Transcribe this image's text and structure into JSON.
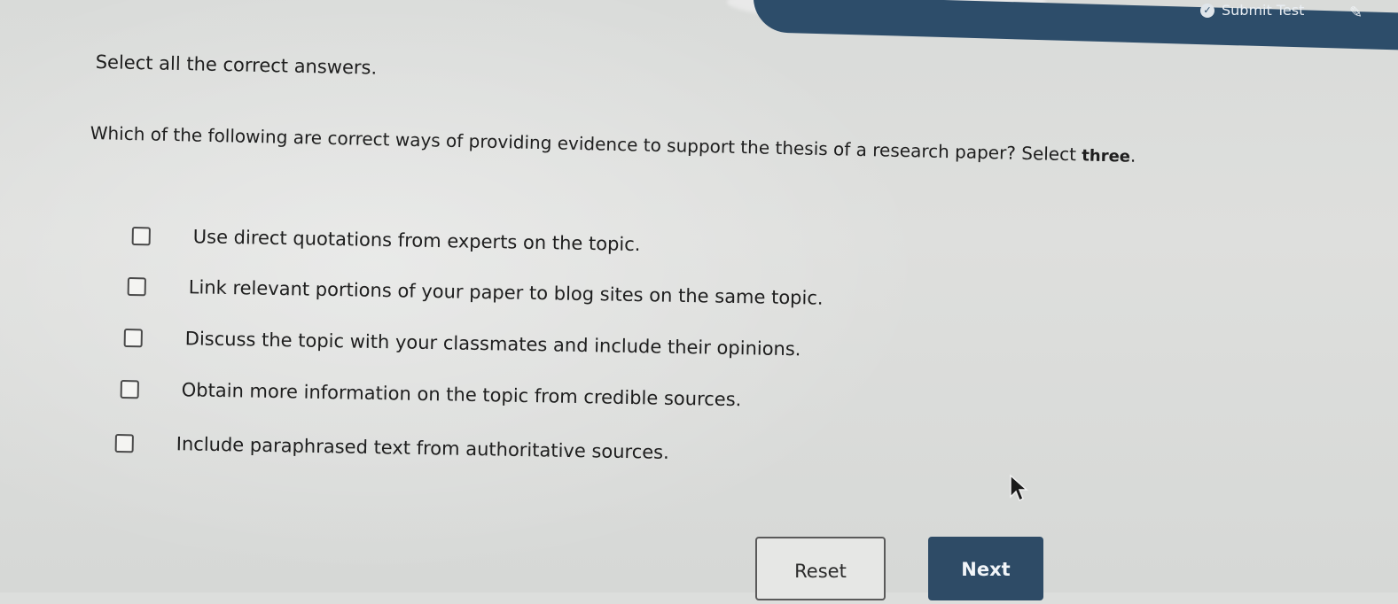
{
  "header": {
    "submit_label": "Submit Test",
    "submit_icon": "check-circle-icon",
    "tool_icon": "pin-icon"
  },
  "question": {
    "instruction": "Select all the correct answers.",
    "prompt": "Which of the following are correct ways of providing evidence to support the thesis of a research paper? Select ",
    "prompt_emphasis": "three",
    "prompt_end": "."
  },
  "options": [
    {
      "label": "Use direct quotations from experts on the topic.",
      "checked": false
    },
    {
      "label": "Link relevant portions of your paper to blog sites on the same topic.",
      "checked": false
    },
    {
      "label": "Discuss the topic with your classmates and include their opinions.",
      "checked": false
    },
    {
      "label": "Obtain more information on the topic from credible sources.",
      "checked": false
    },
    {
      "label": "Include paraphrased text from authoritative sources.",
      "checked": false
    }
  ],
  "buttons": {
    "reset_label": "Reset",
    "next_label": "Next"
  },
  "colors": {
    "accent": "#2e4b66",
    "background": "#dcdedc"
  }
}
